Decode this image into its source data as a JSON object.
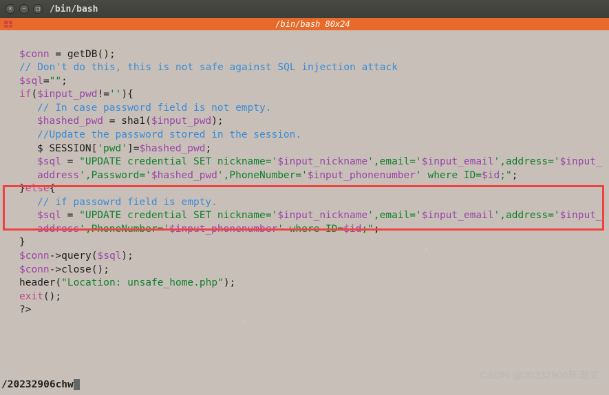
{
  "titlebar": {
    "title": "/bin/bash"
  },
  "statusbar": {
    "center": "/bin/bash 80x24"
  },
  "code": {
    "l1_var": "$conn",
    "l1_rest": " = getDB();",
    "l2_comment": "// Don't do this, this is not safe against SQL injection attack",
    "l3_var": "$sql",
    "l3_rest": "=",
    "l3_str": "\"\"",
    "l3_end": ";",
    "l4_a": "if",
    "l4_b": "(",
    "l4_var": "$input_pwd",
    "l4_c": "!=",
    "l4_str": "''",
    "l4_d": "){",
    "l5_comment": "// In case password field is not empty.",
    "l6_var1": "$hashed_pwd",
    "l6_mid": " = sha1(",
    "l6_var2": "$input_pwd",
    "l6_end": ");",
    "l7_comment": "//Update the password stored in the session.",
    "l8_a": "$ SESSION[",
    "l8_str": "'pwd'",
    "l8_b": "]=",
    "l8_var": "$hashed_pwd",
    "l8_c": ";",
    "l9_var": "$sql",
    "l9_eq": " = ",
    "l9_s1": "\"UPDATE credential SET nickname='",
    "l9_v1": "$input_nickname",
    "l9_s2": "',email='",
    "l9_v2": "$input_email",
    "l9_s3": "',address='",
    "l9_v3": "$input_address",
    "l9_s4": "',Password='",
    "l9_v4": "$hashed_pwd",
    "l9_s5": "',PhoneNumber='",
    "l9_v5": "$input_phonenumber",
    "l9_s6": "' where ID=",
    "l9_v6": "$id",
    "l9_s7": ";\"",
    "l9_end": ";",
    "l10_else": "}",
    "l10_kw": "else",
    "l10_b": "{",
    "l11_comment": "// if passowrd field is empty.",
    "l12_var": "$sql",
    "l12_eq": " = ",
    "l12_s1": "\"UPDATE credential SET nickname='",
    "l12_v1": "$input_nickname",
    "l12_s2": "',email='",
    "l12_v2": "$input_email",
    "l12_s3": "',address='",
    "l12_v3": "$input_address",
    "l12_s4": "',PhoneNumber='",
    "l12_v4": "$input_phonenumber",
    "l12_s5": "' where ID=",
    "l12_v5": "$id",
    "l12_s6": ";\"",
    "l12_end": ";",
    "l13_brace": "}",
    "l14_var": "$conn",
    "l14_a": "->query(",
    "l14_var2": "$sql",
    "l14_b": ");",
    "l15_var": "$conn",
    "l15_rest": "->close();",
    "l16_a": "header(",
    "l16_str": "\"Location: unsafe_home.php\"",
    "l16_b": ");",
    "l17_a": "exit",
    "l17_b": "();",
    "l18": "?>"
  },
  "cmdline": {
    "text": "/20232906chw"
  },
  "watermark": {
    "text": "CSDN @20232906陈瀚文"
  }
}
